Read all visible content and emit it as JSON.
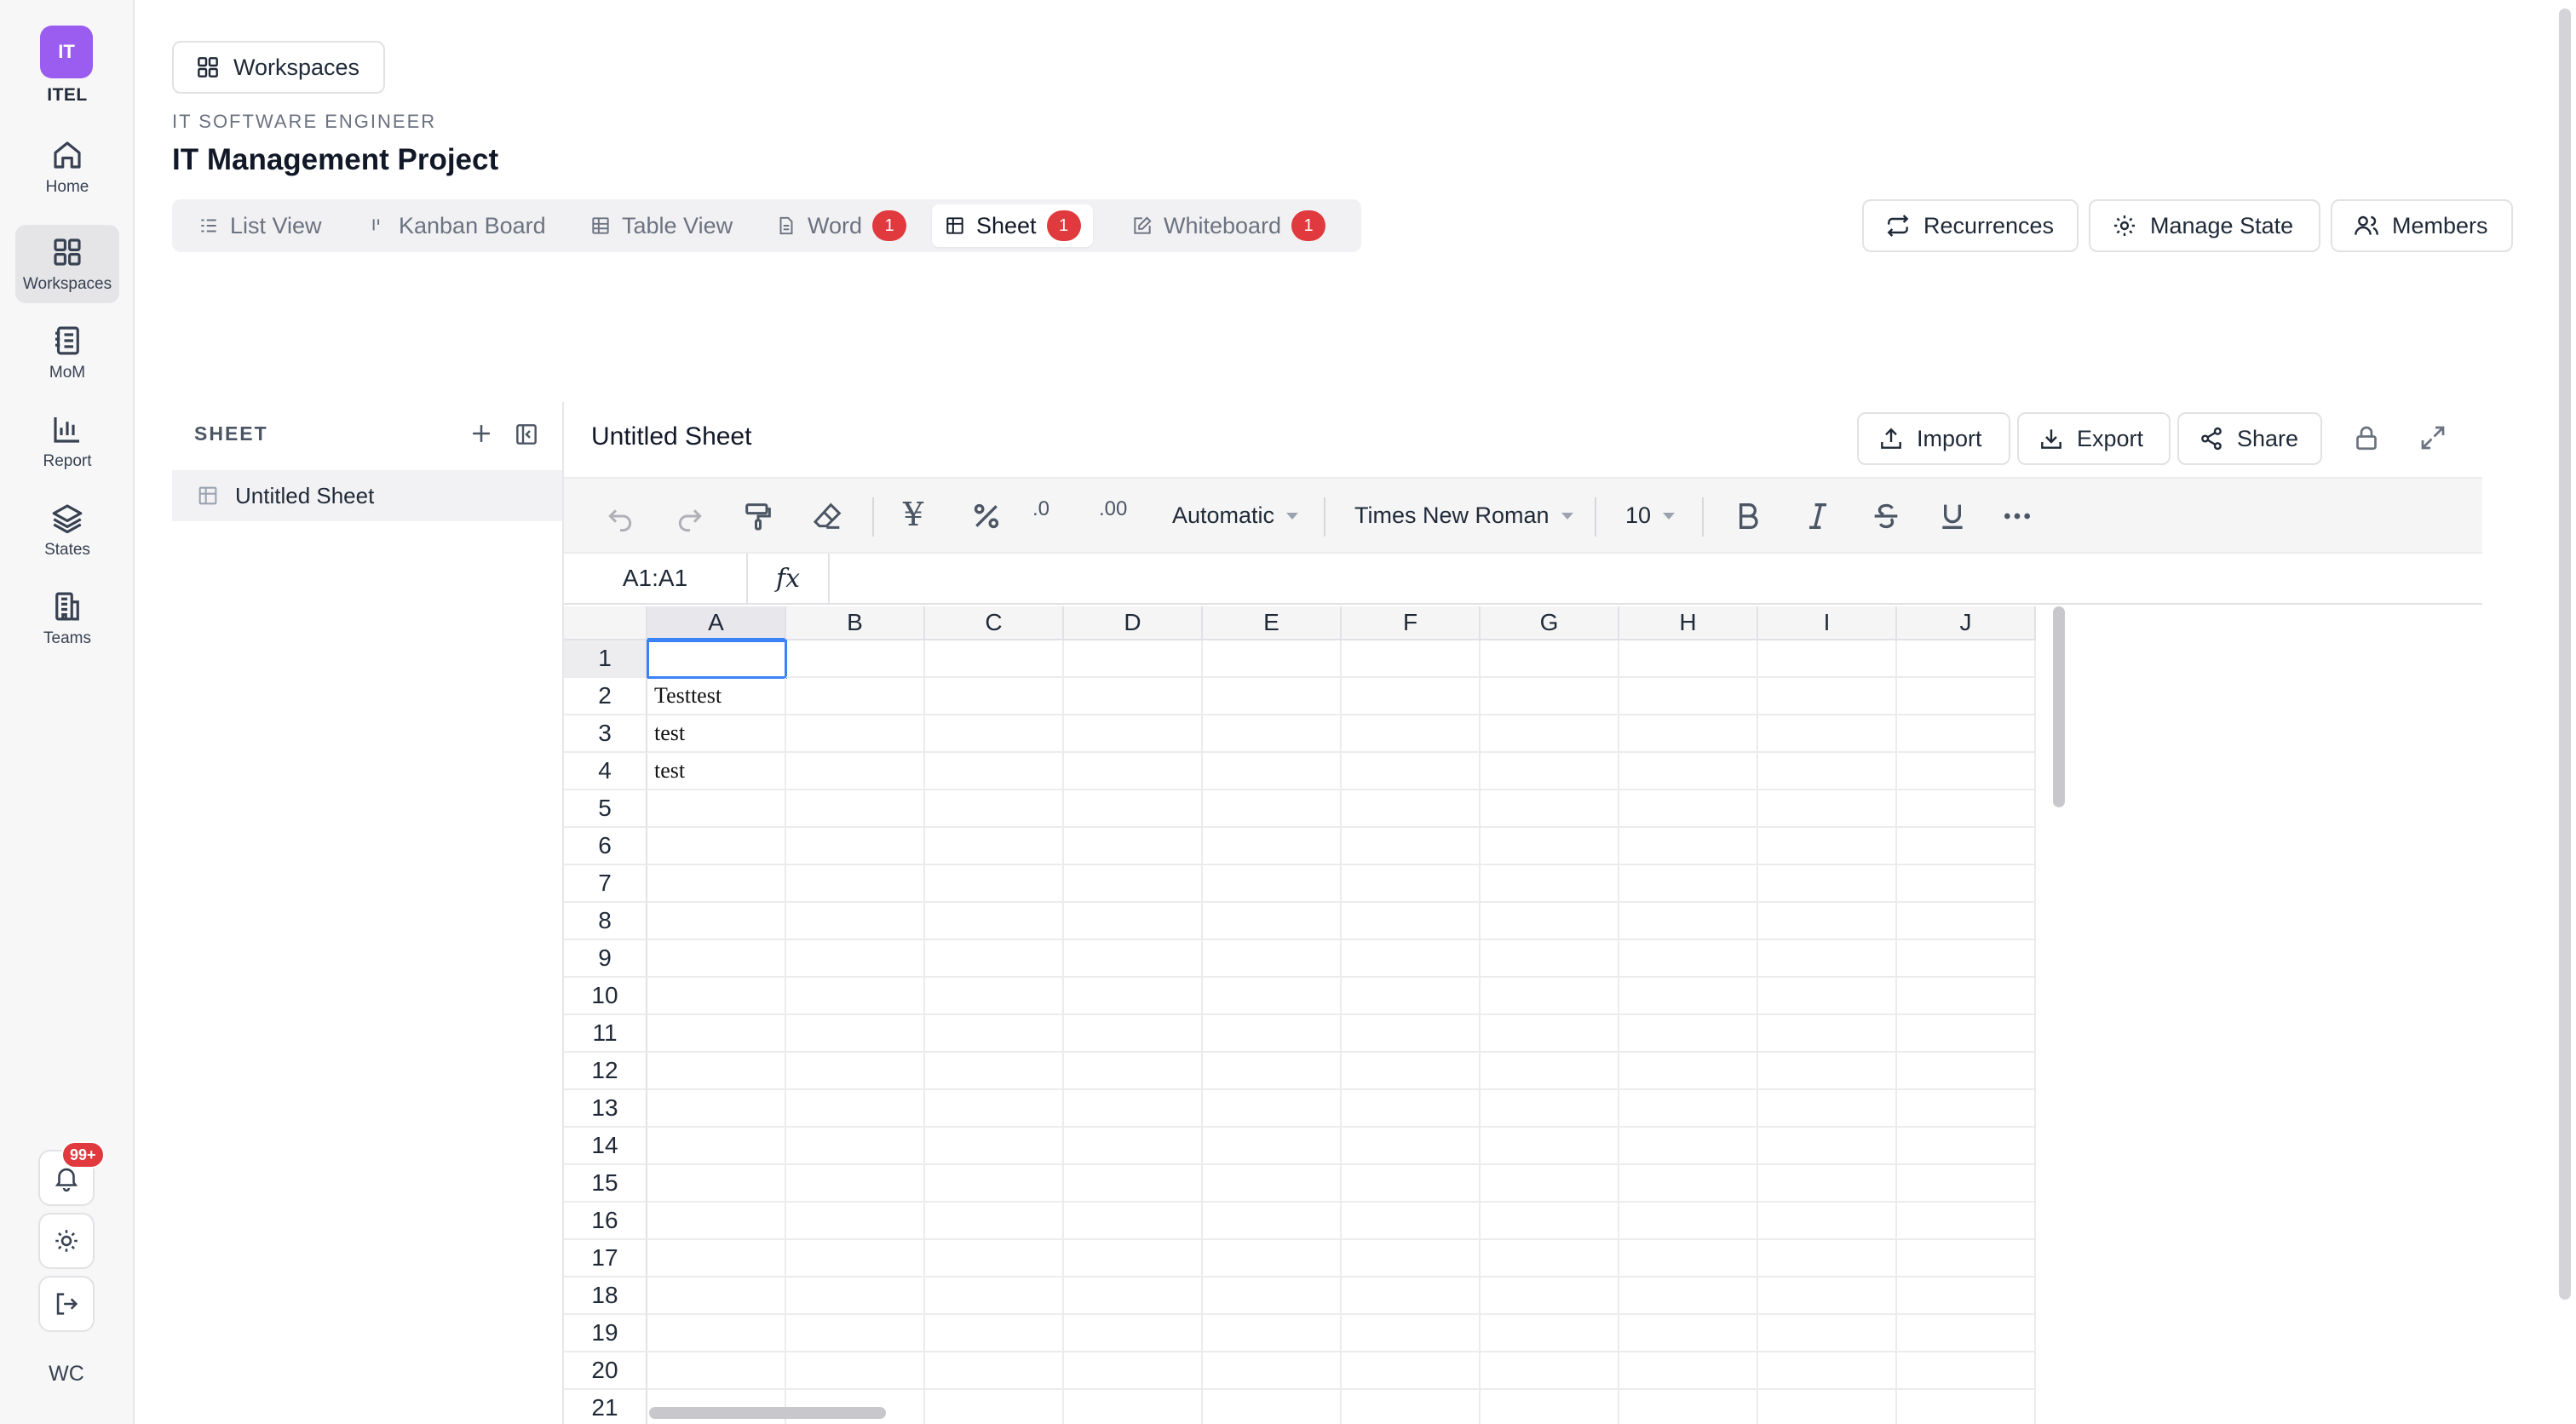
{
  "rail": {
    "brand_initials": "IT",
    "brand_name": "ITEL",
    "items": [
      {
        "label": "Home",
        "icon": "home-icon"
      },
      {
        "label": "Workspaces",
        "icon": "grid-icon"
      },
      {
        "label": "MoM",
        "icon": "notebook-icon"
      },
      {
        "label": "Report",
        "icon": "bar-chart-icon"
      },
      {
        "label": "States",
        "icon": "layers-icon"
      },
      {
        "label": "Teams",
        "icon": "building-icon"
      }
    ],
    "notification_badge": "99+",
    "avatar_initials": "WC"
  },
  "header": {
    "workspaces_button": "Workspaces",
    "subtitle": "IT SOFTWARE ENGINEER",
    "title": "IT Management Project",
    "tabs": [
      {
        "label": "List View"
      },
      {
        "label": "Kanban Board"
      },
      {
        "label": "Table View"
      },
      {
        "label": "Word",
        "badge": "1"
      },
      {
        "label": "Sheet",
        "badge": "1",
        "active": true
      },
      {
        "label": "Whiteboard",
        "badge": "1"
      }
    ],
    "actions": {
      "recurrences": "Recurrences",
      "manage_state": "Manage State",
      "members": "Members"
    }
  },
  "sidebar": {
    "heading": "SHEET",
    "items": [
      {
        "label": "Untitled Sheet"
      }
    ]
  },
  "sheet": {
    "title": "Untitled Sheet",
    "actions": {
      "import": "Import",
      "export": "Export",
      "share": "Share"
    },
    "toolbar": {
      "currency_glyph": "¥",
      "number_format": "Automatic",
      "font_family": "Times New Roman",
      "font_size": "10",
      "decimal_decrease": ".0",
      "decimal_increase": ".00"
    },
    "cell_ref": "A1:A1",
    "fx_label": "fx",
    "columns": [
      "A",
      "B",
      "C",
      "D",
      "E",
      "F",
      "G",
      "H",
      "I",
      "J"
    ],
    "rows": [
      "1",
      "2",
      "3",
      "4",
      "5",
      "6",
      "7",
      "8",
      "9",
      "10",
      "11",
      "12",
      "13",
      "14",
      "15",
      "16",
      "17",
      "18",
      "19",
      "20",
      "21"
    ],
    "cells": {
      "A2": "Testtest",
      "A3": "test",
      "A4": "test"
    }
  },
  "colors": {
    "brand": "#9b5cf0",
    "badge": "#e0393e",
    "selection": "#3b82f6"
  }
}
